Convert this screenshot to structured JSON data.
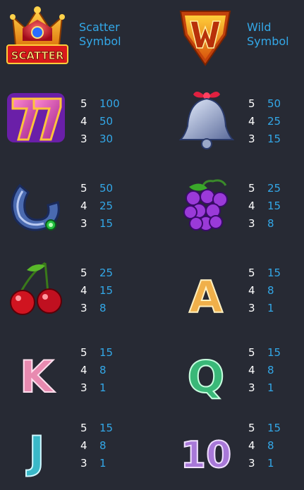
{
  "colors": {
    "background": "#272a34",
    "count": "#ffffff",
    "payout": "#33a8e8"
  },
  "special": {
    "scatter": {
      "icon": "scatter-crown-icon",
      "badge": "SCATTER",
      "label1": "Scatter",
      "label2": "Symbol"
    },
    "wild": {
      "icon": "wild-w-icon",
      "label1": "Wild",
      "label2": "Symbol"
    }
  },
  "symbols": [
    {
      "icon": "seven-icon",
      "pays": [
        {
          "count": "5",
          "value": "100"
        },
        {
          "count": "4",
          "value": "50"
        },
        {
          "count": "3",
          "value": "30"
        }
      ]
    },
    {
      "icon": "bell-icon",
      "pays": [
        {
          "count": "5",
          "value": "50"
        },
        {
          "count": "4",
          "value": "25"
        },
        {
          "count": "3",
          "value": "15"
        }
      ]
    },
    {
      "icon": "horseshoe-icon",
      "pays": [
        {
          "count": "5",
          "value": "50"
        },
        {
          "count": "4",
          "value": "25"
        },
        {
          "count": "3",
          "value": "15"
        }
      ]
    },
    {
      "icon": "grapes-icon",
      "pays": [
        {
          "count": "5",
          "value": "25"
        },
        {
          "count": "4",
          "value": "15"
        },
        {
          "count": "3",
          "value": "8"
        }
      ]
    },
    {
      "icon": "cherries-icon",
      "pays": [
        {
          "count": "5",
          "value": "25"
        },
        {
          "count": "4",
          "value": "15"
        },
        {
          "count": "3",
          "value": "8"
        }
      ]
    },
    {
      "icon": "letter-a-icon",
      "letter": "A",
      "pays": [
        {
          "count": "5",
          "value": "15"
        },
        {
          "count": "4",
          "value": "8"
        },
        {
          "count": "3",
          "value": "1"
        }
      ]
    },
    {
      "icon": "letter-k-icon",
      "letter": "K",
      "pays": [
        {
          "count": "5",
          "value": "15"
        },
        {
          "count": "4",
          "value": "8"
        },
        {
          "count": "3",
          "value": "1"
        }
      ]
    },
    {
      "icon": "letter-q-icon",
      "letter": "Q",
      "pays": [
        {
          "count": "5",
          "value": "15"
        },
        {
          "count": "4",
          "value": "8"
        },
        {
          "count": "3",
          "value": "1"
        }
      ]
    },
    {
      "icon": "letter-j-icon",
      "letter": "J",
      "pays": [
        {
          "count": "5",
          "value": "15"
        },
        {
          "count": "4",
          "value": "8"
        },
        {
          "count": "3",
          "value": "1"
        }
      ]
    },
    {
      "icon": "ten-icon",
      "letter": "10",
      "pays": [
        {
          "count": "5",
          "value": "15"
        },
        {
          "count": "4",
          "value": "8"
        },
        {
          "count": "3",
          "value": "1"
        }
      ]
    }
  ]
}
